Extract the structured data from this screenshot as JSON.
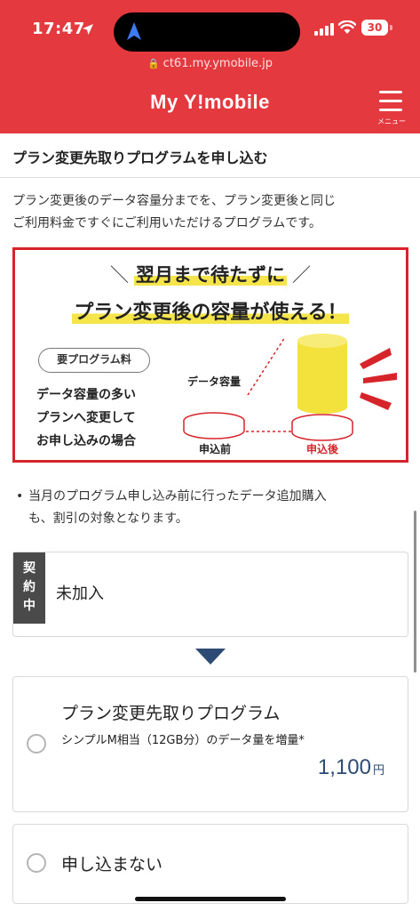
{
  "status_bar": {
    "time": "17:47",
    "battery": "30"
  },
  "browser": {
    "url": "ct61.my.ymobile.jp"
  },
  "header": {
    "brand": "My Y!mobile",
    "menu_label": "メニュー"
  },
  "page": {
    "title": "プラン変更先取りプログラムを申し込む",
    "intro_line1": "プラン変更後のデータ容量分までを、プラン変更後と同じ",
    "intro_line2": "ご利用料金ですぐにご利用いただけるプログラムです。"
  },
  "banner": {
    "slash_left": "＼",
    "headline1": "翌月まで待たずに",
    "slash_right": "／",
    "headline2": "プラン変更後の容量が使える！",
    "fee_tag": "要プログラム料",
    "note_line1": "データ容量の多い",
    "note_line2": "プランへ変更して",
    "note_line3": "お申し込みの場合",
    "data_label": "データ容量",
    "before_label": "申込前",
    "after_label": "申込後"
  },
  "notice": {
    "bullet": "•",
    "line1": "当月のプログラム申し込み前に行ったデータ追加購入",
    "line2": "も、割引の対象となります。"
  },
  "current_plan": {
    "tag": "契約中",
    "tag_chars": [
      "契",
      "約",
      "中"
    ],
    "value": "未加入"
  },
  "options": [
    {
      "title": "プラン変更先取りプログラム",
      "description": "シンプルM相当（12GB分）のデータ量を増量*",
      "price": "1,100",
      "currency": "円",
      "selected": false
    },
    {
      "title": "申し込まない",
      "selected": false
    }
  ],
  "colors": {
    "brand_red": "#e4393f",
    "highlight_yellow": "#f5e44a",
    "price_navy": "#2e4b73",
    "arrow_navy": "#2e4b73"
  }
}
